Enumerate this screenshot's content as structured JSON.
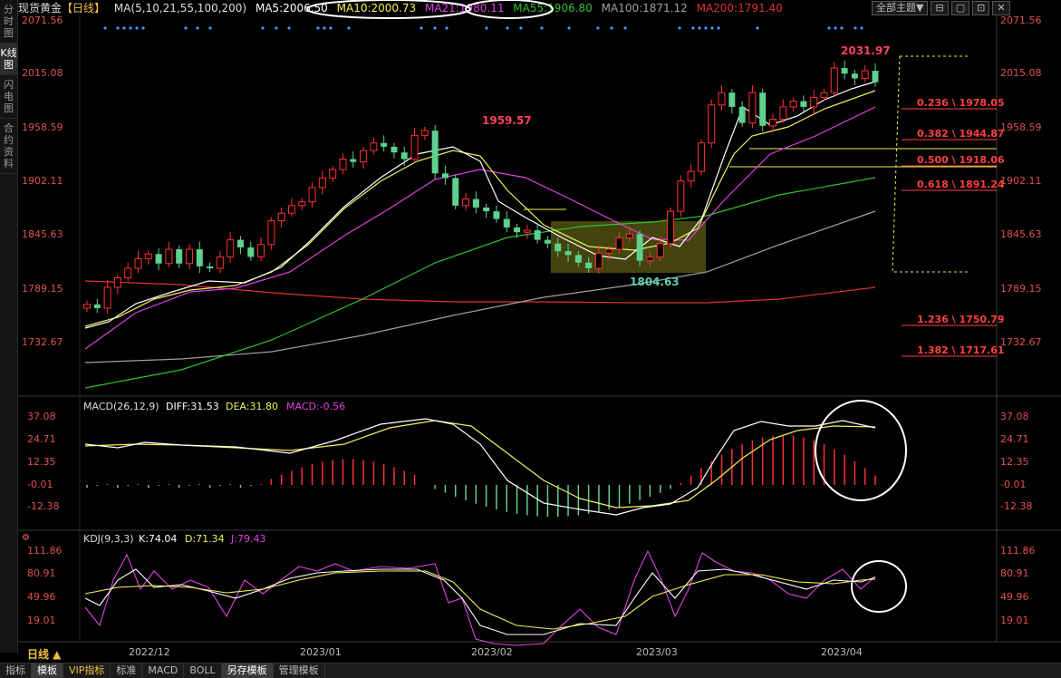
{
  "left_tabs": [
    "分时图",
    "K线图",
    "闪电图",
    "合约资料"
  ],
  "header": {
    "symbol": "现货黄金",
    "period": "【日线】",
    "ma_params": "MA(5,10,21,55,100,200)",
    "ma5": "MA5:2006.50",
    "ma10": "MA10:2000.73",
    "ma21": "MA21:1980.11",
    "ma55": "MA55:1906.80",
    "ma100": "MA100:1871.12",
    "ma200": "MA200:1791.40"
  },
  "top_buttons": {
    "subject": "全部主题▼",
    "b1": "⊟",
    "b2": "▢",
    "b3": "⊡",
    "b4": "✕"
  },
  "price_axis": [
    "2071.56",
    "2015.08",
    "1958.59",
    "1902.11",
    "1845.63",
    "1789.15",
    "1732.67"
  ],
  "annotations": {
    "high": "1959.57",
    "high2": "2031.97",
    "low": "1804.63"
  },
  "fib": [
    "0.236 \\ 1978.05",
    "0.382 \\ 1944.87",
    "0.500 \\ 1918.06",
    "0.618 \\ 1891.24",
    "1.236 \\ 1750.79",
    "1.382 \\ 1717.61"
  ],
  "macd": {
    "label": "MACD(26,12,9)",
    "diff": "DIFF:31.53",
    "dea": "DEA:31.80",
    "macd": "MACD:-0.56",
    "axis": [
      "37.08",
      "24.71",
      "12.35",
      "-0.01",
      "-12.38"
    ]
  },
  "kdj": {
    "label": "KDJ(9,3,3)",
    "k": "K:74.04",
    "d": "D:71.34",
    "j": "J:79.43",
    "axis": [
      "111.86",
      "80.91",
      "49.96",
      "19.01"
    ]
  },
  "x_labels": [
    "2022/12",
    "2023/01",
    "2023/02",
    "2023/03",
    "2023/04"
  ],
  "period_label": "日线 ▲",
  "bottom_tabs": [
    "指标",
    "模板",
    "VIP指标",
    "标准",
    "MACD",
    "BOLL",
    "另存模板",
    "管理模板"
  ],
  "colors": {
    "up": "#ff3030",
    "down": "#5fd08e",
    "ma5": "#ffffff",
    "ma10": "#f2f25a",
    "ma21": "#e040e0",
    "ma55": "#30c030",
    "ma100": "#a0a0a0",
    "ma200": "#e03030"
  },
  "chart_data": {
    "type": "candlestick",
    "title": "现货黄金 日线",
    "x": [
      "2022/12",
      "2023/01",
      "2023/02",
      "2023/03",
      "2023/04"
    ],
    "ylim": [
      1700,
      2080
    ],
    "close_path": [
      1772,
      1768,
      1790,
      1800,
      1810,
      1820,
      1825,
      1815,
      1830,
      1815,
      1830,
      1812,
      1810,
      1822,
      1840,
      1832,
      1822,
      1835,
      1860,
      1868,
      1876,
      1880,
      1895,
      1905,
      1914,
      1925,
      1922,
      1934,
      1942,
      1938,
      1932,
      1925,
      1950,
      1955,
      1910,
      1905,
      1876,
      1883,
      1874,
      1870,
      1862,
      1853,
      1848,
      1850,
      1840,
      1836,
      1828,
      1824,
      1816,
      1810,
      1826,
      1830,
      1842,
      1846,
      1818,
      1822,
      1836,
      1870,
      1902,
      1912,
      1942,
      1982,
      1995,
      1980,
      1963,
      1995,
      1960,
      1967,
      1980,
      1986,
      1980,
      1990,
      1995,
      2021,
      2015,
      2010,
      2018,
      2006
    ],
    "macd_diff_range": [
      -12.38,
      37.08
    ],
    "kdj_range": [
      19.01,
      111.86
    ]
  }
}
